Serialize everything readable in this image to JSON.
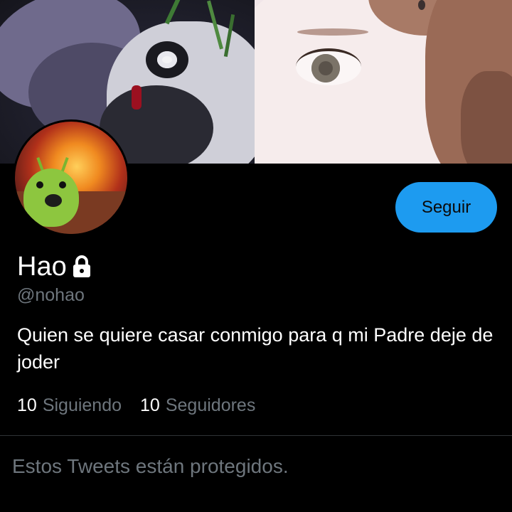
{
  "profile": {
    "name": "Hao",
    "handle": "@nohao",
    "bio": "Quien se quiere casar conmigo para q mi Padre deje de joder",
    "protected_icon": "lock-icon"
  },
  "actions": {
    "follow_label": "Seguir"
  },
  "stats": {
    "following_count": "10",
    "following_label": "Siguiendo",
    "followers_count": "10",
    "followers_label": "Seguidores"
  },
  "tweets": {
    "protected_message": "Estos Tweets están protegidos."
  },
  "colors": {
    "accent": "#1d9bf0",
    "muted_text": "#6e767d",
    "background": "#000000"
  }
}
